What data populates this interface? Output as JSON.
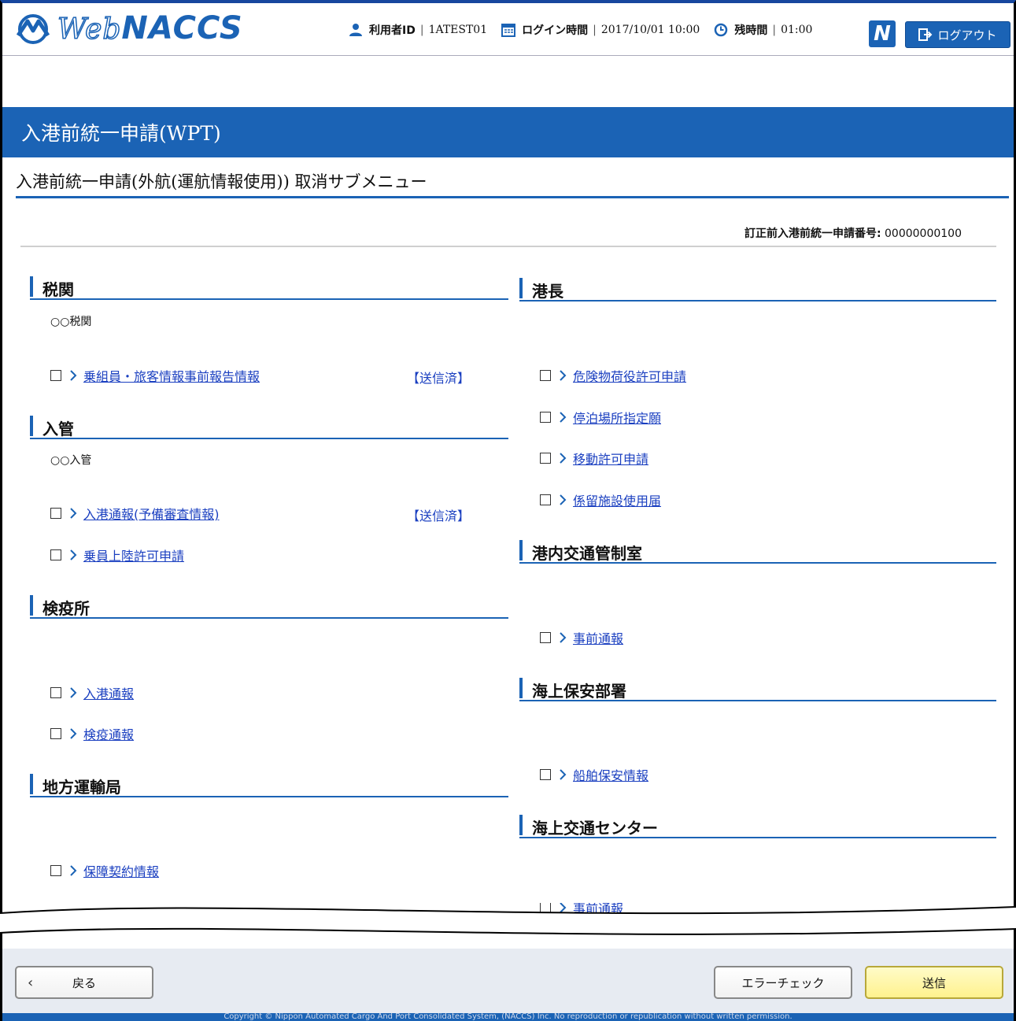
{
  "header": {
    "logo_text_web": "Web",
    "logo_text_naccs": "NACCS",
    "user_id_label": "利用者ID",
    "user_id_value": "1ATEST01",
    "login_time_label": "ログイン時間",
    "login_time_value": "2017/10/01 10:00",
    "remaining_label": "残時間",
    "remaining_value": "01:00",
    "n_button_label": "N",
    "logout_label": "ログアウト"
  },
  "page_title": "入港前統一申請(WPT)",
  "subtitle": "入港前統一申請(外航(運航情報使用)) 取消サブメニュー",
  "reference": {
    "label": "訂正前入港前統一申請番号:",
    "value": "00000000100"
  },
  "left_sections": [
    {
      "title": "税関",
      "office": "○○税関",
      "items": [
        {
          "label": "乗組員・旅客情報事前報告情報",
          "status": "【送信済】"
        }
      ]
    },
    {
      "title": "入管",
      "office": "○○入管",
      "items": [
        {
          "label": "入港通報(予備審査情報)",
          "status": "【送信済】"
        },
        {
          "label": "乗員上陸許可申請",
          "status": ""
        }
      ]
    },
    {
      "title": "検疫所",
      "office": "",
      "items": [
        {
          "label": "入港通報",
          "status": ""
        },
        {
          "label": "検疫通報",
          "status": ""
        }
      ]
    },
    {
      "title": "地方運輸局",
      "office": "",
      "items": [
        {
          "label": "保障契約情報",
          "status": ""
        }
      ]
    }
  ],
  "right_sections": [
    {
      "title": "港長",
      "items": [
        {
          "label": "危険物荷役許可申請"
        },
        {
          "label": "停泊場所指定願"
        },
        {
          "label": "移動許可申請"
        },
        {
          "label": "係留施設使用届"
        }
      ]
    },
    {
      "title": "港内交通管制室",
      "items": [
        {
          "label": "事前通報"
        }
      ]
    },
    {
      "title": "海上保安部署",
      "items": [
        {
          "label": "船舶保安情報"
        }
      ]
    },
    {
      "title": "海上交通センター",
      "items": [
        {
          "label": "事前通報"
        }
      ]
    }
  ],
  "footer": {
    "back_label": "戻る",
    "error_check_label": "エラーチェック",
    "send_label": "送信",
    "copyright": "Copyright © Nippon Automated Cargo And Port Consolidated System, (NACCS) Inc. No reproduction or republication without written permission."
  },
  "colors": {
    "brand_blue": "#1b63b5",
    "send_yellow": "#fff28e"
  }
}
